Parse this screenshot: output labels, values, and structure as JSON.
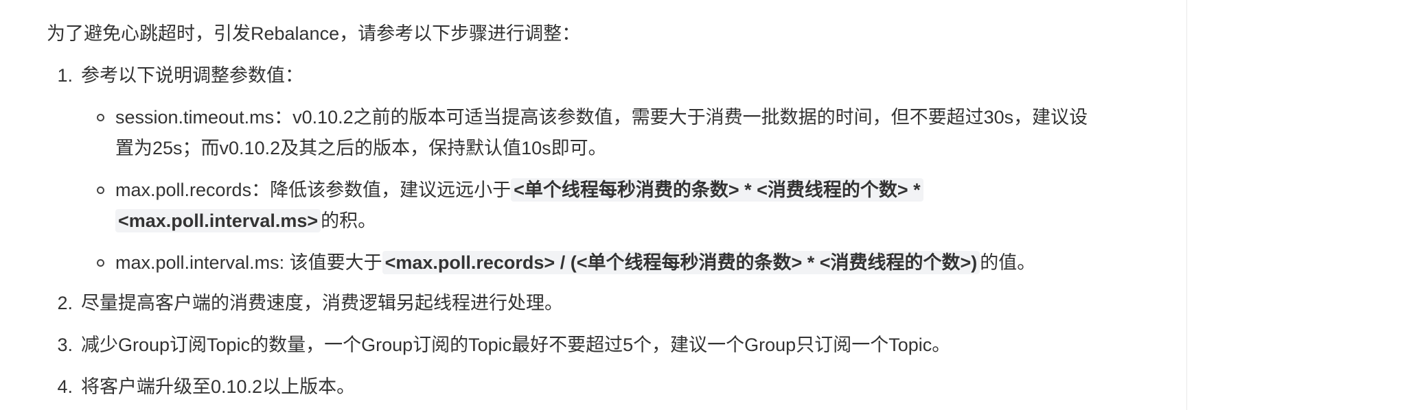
{
  "intro": "为了避免心跳超时，引发Rebalance，请参考以下步骤进行调整：",
  "steps": [
    {
      "num": "1.",
      "text": "参考以下说明调整参数值：",
      "subitems": [
        {
          "line1": "session.timeout.ms：v0.10.2之前的版本可适当提高该参数值，需要大于消费一批数据的时间，但不要超过30s，建议设",
          "line2": "置为25s；而v0.10.2及其之后的版本，保持默认值10s即可。"
        },
        {
          "prefix": "max.poll.records：降低该参数值，建议远远小于",
          "code1": "<单个线程每秒消费的条数> * <消费线程的个数> *",
          "code2": "<max.poll.interval.ms>",
          "suffix": "的积。"
        },
        {
          "prefix": "max.poll.interval.ms: 该值要大于",
          "code": "<max.poll.records> / (<单个线程每秒消费的条数> * <消费线程的个数>)",
          "suffix": "的值。"
        }
      ]
    },
    {
      "num": "2.",
      "text": "尽量提高客户端的消费速度，消费逻辑另起线程进行处理。"
    },
    {
      "num": "3.",
      "text": "减少Group订阅Topic的数量，一个Group订阅的Topic最好不要超过5个，建议一个Group只订阅一个Topic。"
    },
    {
      "num": "4.",
      "text": "将客户端升级至0.10.2以上版本。"
    }
  ]
}
